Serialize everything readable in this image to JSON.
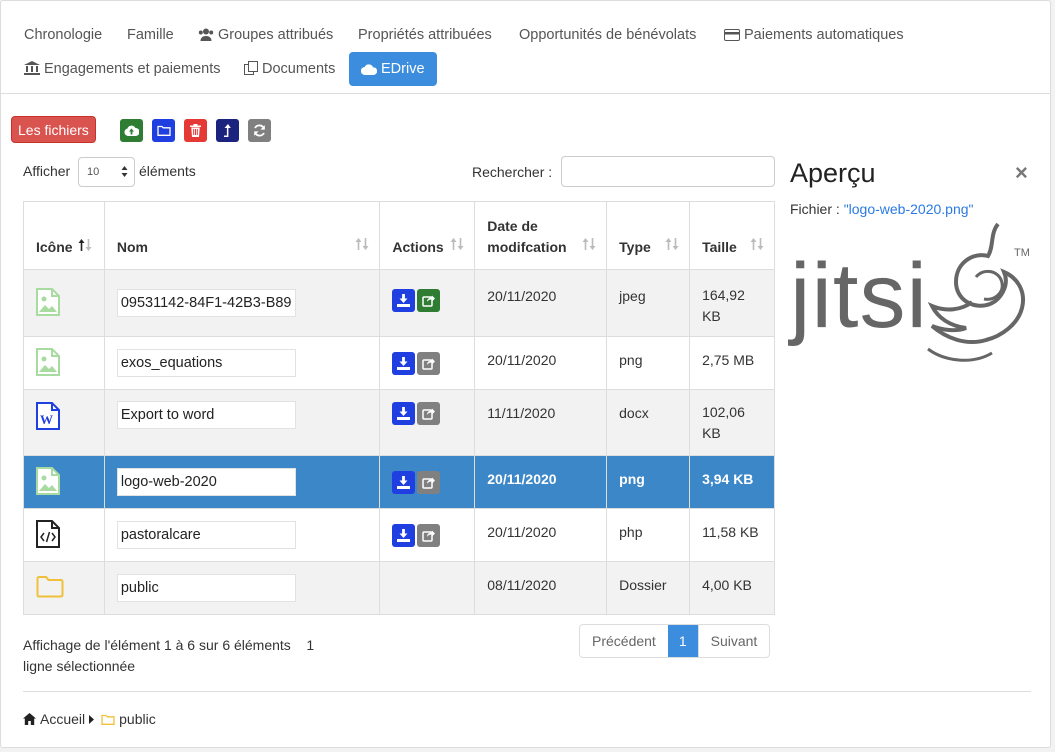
{
  "tabs": {
    "chronologie": "Chronologie",
    "famille": "Famille",
    "groupes": "Groupes attribués",
    "proprietes": "Propriétés attribuées",
    "opportunites": "Opportunités de bénévolats",
    "paiements_auto": "Paiements automatiques",
    "engagements": "Engagements et paiements",
    "documents": "Documents",
    "edrive": "EDrive"
  },
  "toolbar": {
    "files_label": "Les fichiers"
  },
  "controls": {
    "show_label": "Afficher",
    "page_size": "10",
    "elements_label": "éléments",
    "search_label": "Rechercher :"
  },
  "table": {
    "headers": {
      "icon": "Icône",
      "name": "Nom",
      "actions": "Actions",
      "date": "Date de modifcation",
      "type": "Type",
      "size": "Taille"
    },
    "rows": [
      {
        "icon": "image-file-icon",
        "name": "09531142-84F1-42B3-B89",
        "date": "20/11/2020",
        "type": "jpeg",
        "size": "164,92 KB"
      },
      {
        "icon": "image-file-icon",
        "name": "exos_equations",
        "date": "20/11/2020",
        "type": "png",
        "size": "2,75 MB"
      },
      {
        "icon": "word-file-icon",
        "name": "Export to word",
        "date": "11/11/2020",
        "type": "docx",
        "size": "102,06 KB"
      },
      {
        "icon": "image-file-icon",
        "name": "logo-web-2020",
        "date": "20/11/2020",
        "type": "png",
        "size": "3,94 KB"
      },
      {
        "icon": "code-file-icon",
        "name": "pastoralcare",
        "date": "20/11/2020",
        "type": "php",
        "size": "11,58 KB"
      },
      {
        "icon": "folder-icon",
        "name": "public",
        "date": "08/11/2020",
        "type": "Dossier",
        "size": "4,00 KB"
      }
    ]
  },
  "footer": {
    "info": "Affichage de l'élément 1 à 6 sur 6 éléments",
    "selected": "1 ligne sélectionnée",
    "prev": "Précédent",
    "page": "1",
    "next": "Suivant"
  },
  "breadcrumb": {
    "home": "Accueil",
    "folder": "public"
  },
  "preview": {
    "title": "Aperçu",
    "file_label": "Fichier :",
    "file_name": "\"logo-web-2020.png\"",
    "close": "×",
    "logo_text": "jitsi",
    "logo_tm": "TM"
  },
  "colors": {
    "accent": "#3c8dde",
    "danger": "#d9534f",
    "upload": "#2e7d32",
    "folder_btn": "#1f3fe0",
    "delete": "#e53935",
    "navy": "#1a237e",
    "grey": "#808080"
  }
}
